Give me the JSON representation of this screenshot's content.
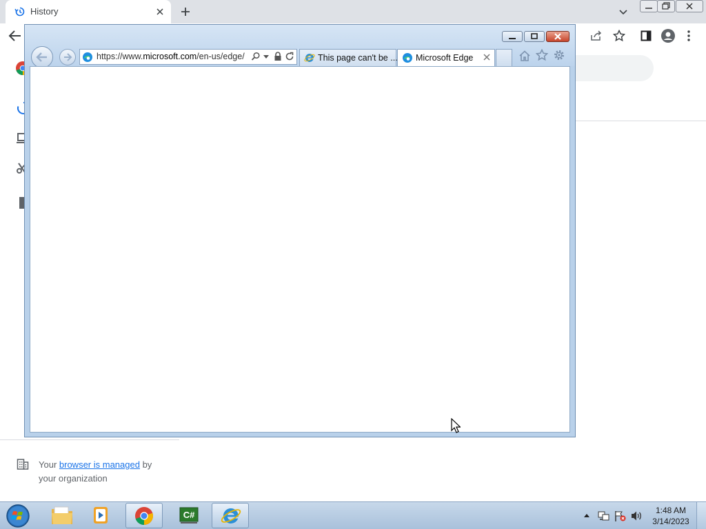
{
  "chrome": {
    "tab_title": "History",
    "managed_notice": {
      "prefix": "Your ",
      "link": "browser is managed",
      "suffix": " by",
      "line2": "your organization"
    }
  },
  "ie": {
    "address_url_prefix": "https://www.",
    "address_url_domain": "microsoft.com",
    "address_url_path": "/en-us/edge/",
    "tabs": [
      {
        "title": "This page can't be ...",
        "active": false
      },
      {
        "title": "Microsoft Edge",
        "active": true
      }
    ]
  },
  "taskbar": {
    "items": [
      "file-explorer",
      "media-player",
      "chrome",
      "csharp-editor",
      "internet-explorer"
    ],
    "clock_time": "1:48 AM",
    "clock_date": "3/14/2023"
  },
  "colors": {
    "chrome_accent": "#1a73e8",
    "ie_frame": "#b9d1ea",
    "taskbar": "#b4cbe3"
  }
}
